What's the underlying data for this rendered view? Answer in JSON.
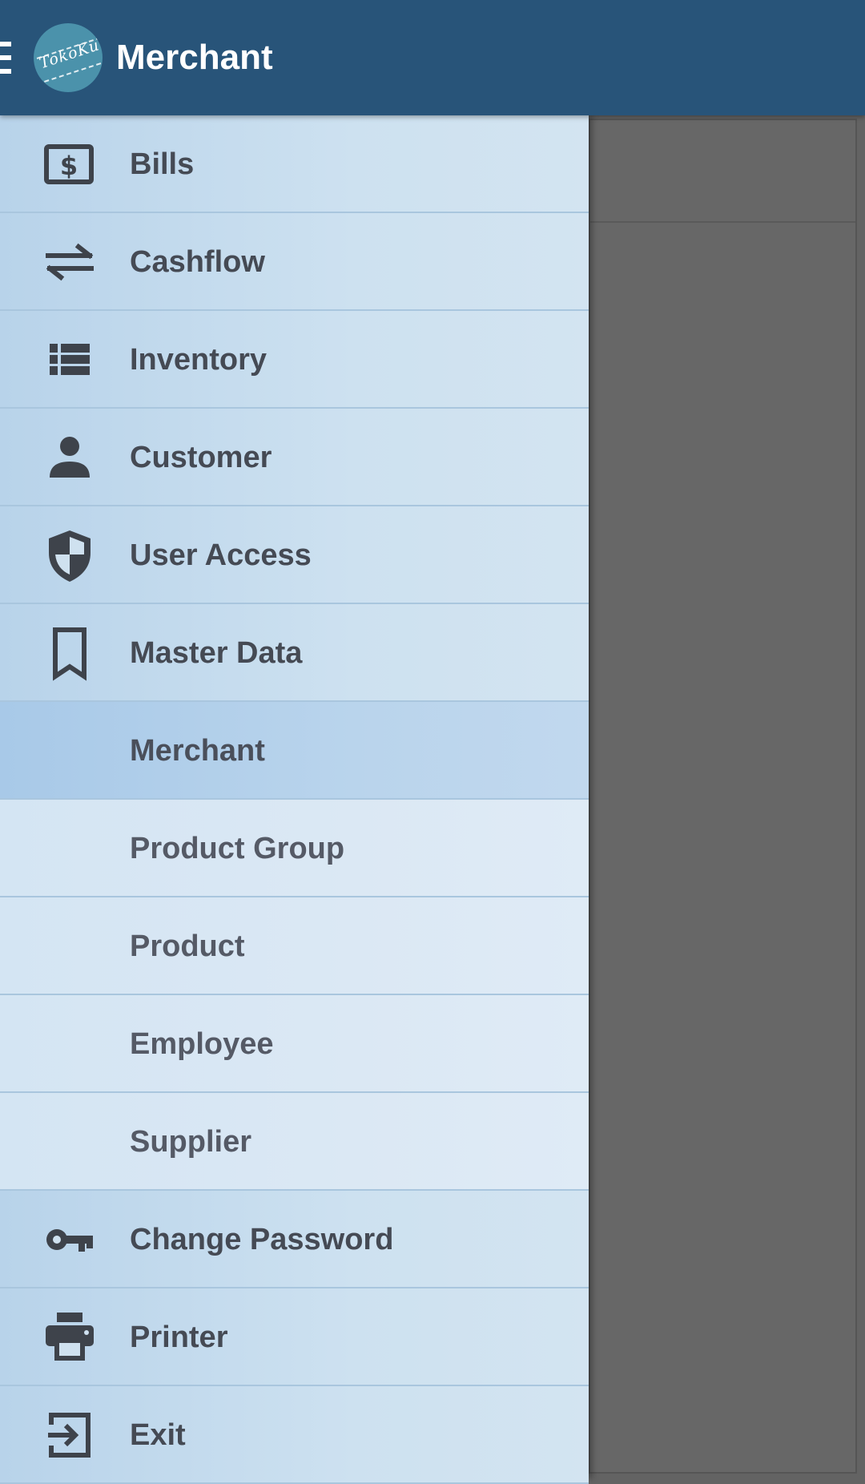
{
  "app_bar": {
    "title": "Merchant",
    "logo_text": "TokoKu",
    "menu_icon": "hamburger-icon",
    "color": "#285479"
  },
  "drawer": {
    "items": [
      {
        "label": "Bills",
        "icon": "bill-icon",
        "type": "main"
      },
      {
        "label": "Cashflow",
        "icon": "swap-arrows-icon",
        "type": "main"
      },
      {
        "label": "Inventory",
        "icon": "list-icon",
        "type": "main"
      },
      {
        "label": "Customer",
        "icon": "person-icon",
        "type": "main"
      },
      {
        "label": "User Access",
        "icon": "shield-icon",
        "type": "main"
      },
      {
        "label": "Master Data",
        "icon": "bookmark-icon",
        "type": "main"
      },
      {
        "label": "Merchant",
        "icon": "",
        "type": "sub",
        "selected": true
      },
      {
        "label": "Product Group",
        "icon": "",
        "type": "sub"
      },
      {
        "label": "Product",
        "icon": "",
        "type": "sub"
      },
      {
        "label": "Employee",
        "icon": "",
        "type": "sub"
      },
      {
        "label": "Supplier",
        "icon": "",
        "type": "sub"
      },
      {
        "label": "Change Password",
        "icon": "key-icon",
        "type": "main"
      },
      {
        "label": "Printer",
        "icon": "printer-icon",
        "type": "main"
      },
      {
        "label": "Exit",
        "icon": "exit-icon",
        "type": "main"
      }
    ]
  }
}
